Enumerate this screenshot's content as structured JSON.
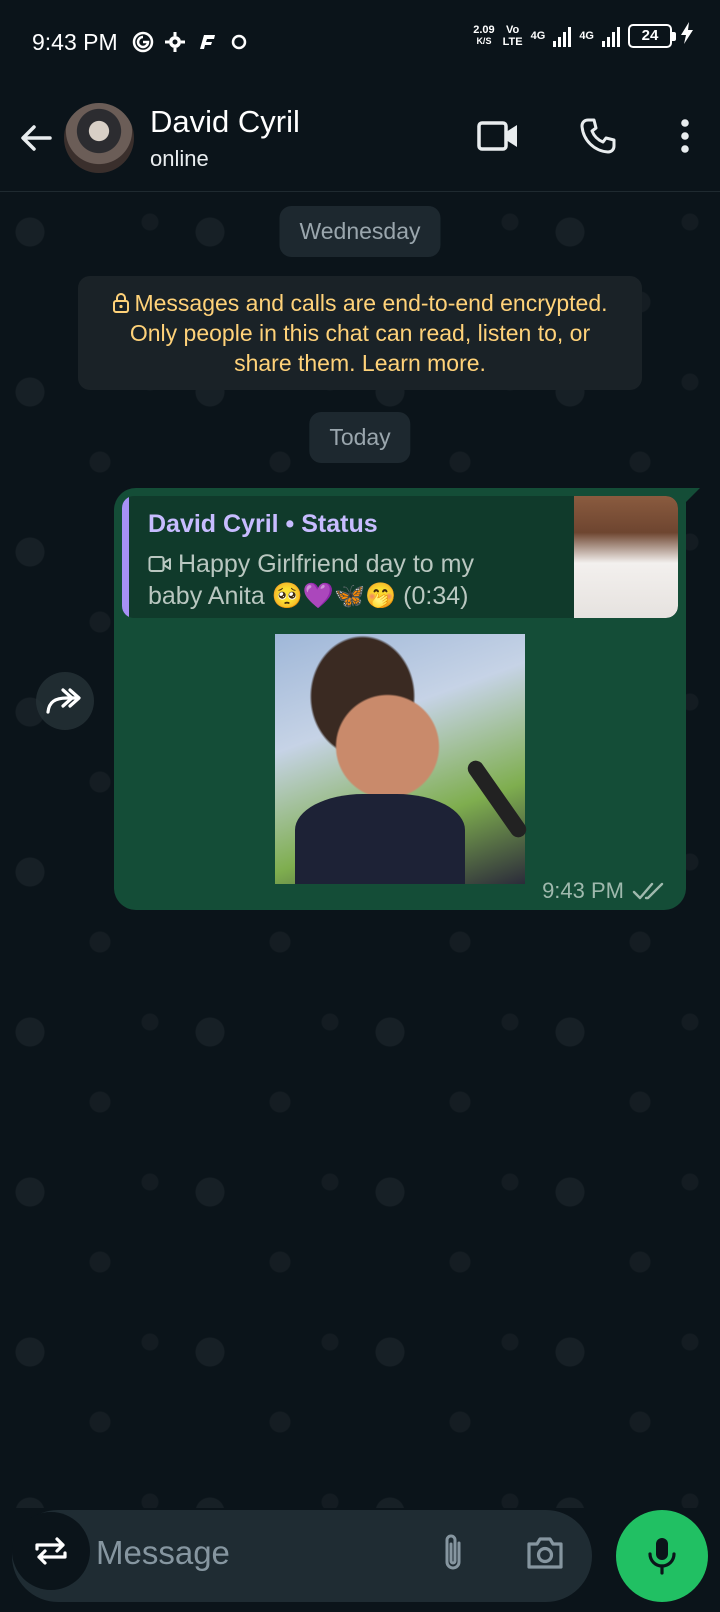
{
  "status_bar": {
    "time": "9:43 PM",
    "speed_value": "2.09",
    "speed_unit": "K/S",
    "volte_top": "Vo",
    "volte_bottom": "LTE",
    "net1": "4G",
    "net2": "4G",
    "battery": "24"
  },
  "header": {
    "contact_name": "David Cyril",
    "contact_status": "online"
  },
  "chat": {
    "date_pill_1": "Wednesday",
    "encryption_notice": "Messages and calls are end-to-end encrypted. Only people in this chat can read, listen to, or share them. Learn more.",
    "date_pill_2": "Today",
    "message": {
      "quote_title": "David Cyril • Status",
      "quote_text": "Happy Girlfriend day to my baby Anita 🥺💜🦋🤭 (0:34)",
      "time": "9:43 PM"
    }
  },
  "input": {
    "placeholder": "Message"
  },
  "colors": {
    "background": "#0b141a",
    "bubble": "#144d37",
    "accent_green": "#21c063",
    "encryption_text": "#ffd279",
    "quote_title": "#c7bcff"
  },
  "icons": [
    "back-arrow-icon",
    "video-call-icon",
    "phone-icon",
    "more-vert-icon",
    "lock-icon",
    "video-icon",
    "forward-icon",
    "double-check-icon",
    "swap-icon",
    "attach-icon",
    "camera-icon",
    "mic-icon"
  ]
}
